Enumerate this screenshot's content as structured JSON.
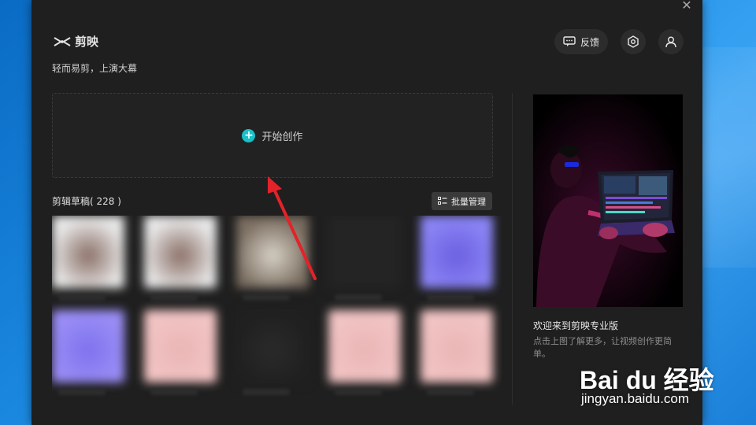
{
  "app": {
    "name": "剪映",
    "tagline": "轻而易剪，上演大幕",
    "close_glyph": "✕"
  },
  "header": {
    "feedback_label": "反馈",
    "feedback_icon": "chat-bubble-icon",
    "settings_icon": "settings-hex-icon",
    "user_icon": "user-icon"
  },
  "create": {
    "label": "开始创作",
    "icon": "plus-circle-icon",
    "icon_color": "#18c1c9"
  },
  "drafts": {
    "title": "剪辑草稿( 228 )",
    "batch_label": "批量管理",
    "thumbnails": [
      {
        "colors": [
          "#e9e9e9",
          "#8a6f66"
        ]
      },
      {
        "colors": [
          "#e9e9e9",
          "#8a6f66"
        ]
      },
      {
        "colors": [
          "#7a6d60",
          "#d8d2c6"
        ]
      },
      {
        "colors": [
          "#242424",
          "#242424"
        ]
      },
      {
        "colors": [
          "#8a84f5",
          "#6b5fe0"
        ]
      },
      {
        "colors": [
          "#9a8df6",
          "#7e72ee"
        ]
      },
      {
        "colors": [
          "#f2c4c4",
          "#eab5b5"
        ]
      },
      {
        "colors": [
          "#202020",
          "#2a2a2a"
        ]
      },
      {
        "colors": [
          "#f2c4c4",
          "#eab5b5"
        ]
      },
      {
        "colors": [
          "#f2c4c4",
          "#eab5b5"
        ]
      }
    ]
  },
  "promo": {
    "title": "欢迎来到剪映专业版",
    "description": "点击上图了解更多，让视频创作更简单。"
  },
  "watermark": {
    "brand": "Bai du 经验",
    "url": "jingyan.baidu.com"
  },
  "colors": {
    "accent": "#18c1c9",
    "annotation_arrow": "#e3222a",
    "window_bg": "#1f1f1f"
  }
}
